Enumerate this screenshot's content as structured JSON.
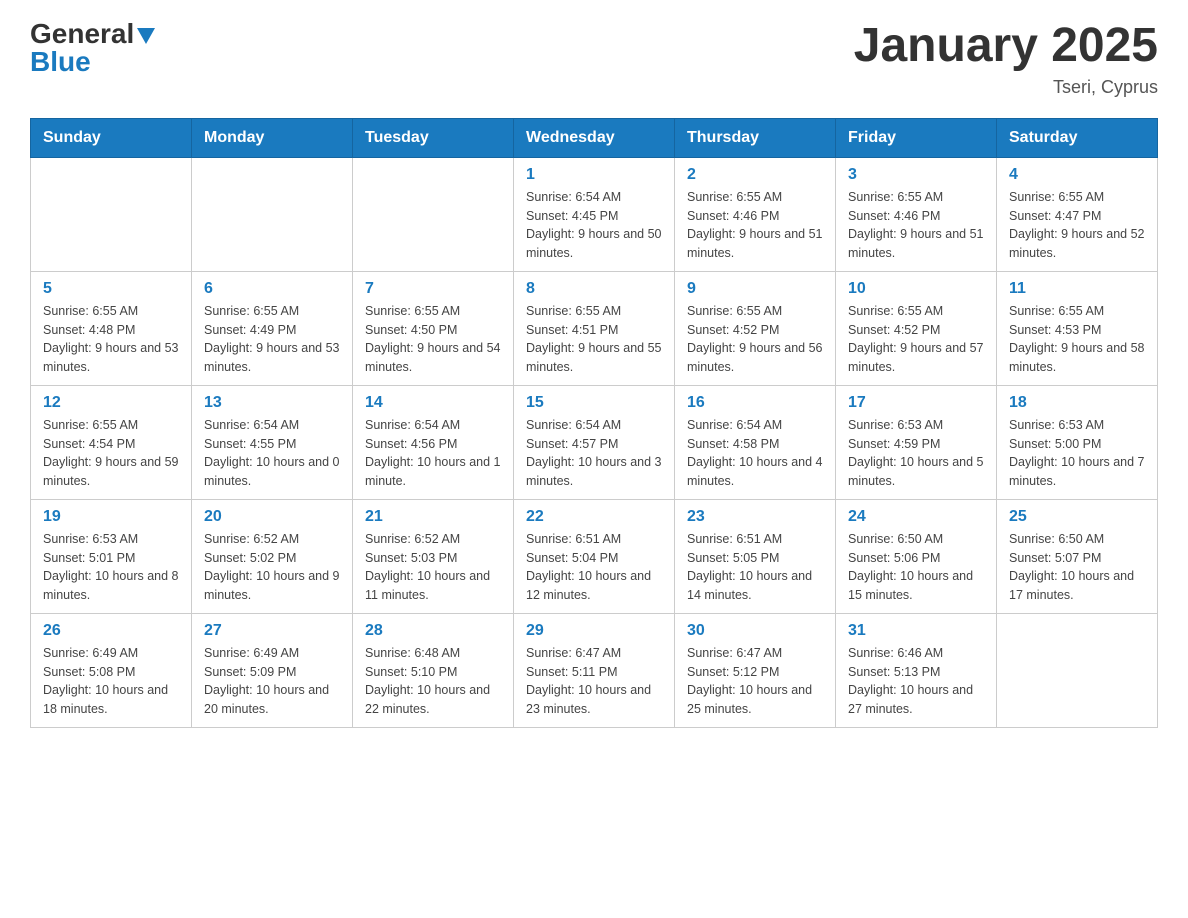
{
  "header": {
    "title": "January 2025",
    "location": "Tseri, Cyprus",
    "logo_general": "General",
    "logo_blue": "Blue"
  },
  "weekdays": [
    "Sunday",
    "Monday",
    "Tuesday",
    "Wednesday",
    "Thursday",
    "Friday",
    "Saturday"
  ],
  "weeks": [
    [
      {
        "day": null
      },
      {
        "day": null
      },
      {
        "day": null
      },
      {
        "day": "1",
        "sunrise": "6:54 AM",
        "sunset": "4:45 PM",
        "daylight": "9 hours and 50 minutes."
      },
      {
        "day": "2",
        "sunrise": "6:55 AM",
        "sunset": "4:46 PM",
        "daylight": "9 hours and 51 minutes."
      },
      {
        "day": "3",
        "sunrise": "6:55 AM",
        "sunset": "4:46 PM",
        "daylight": "9 hours and 51 minutes."
      },
      {
        "day": "4",
        "sunrise": "6:55 AM",
        "sunset": "4:47 PM",
        "daylight": "9 hours and 52 minutes."
      }
    ],
    [
      {
        "day": "5",
        "sunrise": "6:55 AM",
        "sunset": "4:48 PM",
        "daylight": "9 hours and 53 minutes."
      },
      {
        "day": "6",
        "sunrise": "6:55 AM",
        "sunset": "4:49 PM",
        "daylight": "9 hours and 53 minutes."
      },
      {
        "day": "7",
        "sunrise": "6:55 AM",
        "sunset": "4:50 PM",
        "daylight": "9 hours and 54 minutes."
      },
      {
        "day": "8",
        "sunrise": "6:55 AM",
        "sunset": "4:51 PM",
        "daylight": "9 hours and 55 minutes."
      },
      {
        "day": "9",
        "sunrise": "6:55 AM",
        "sunset": "4:52 PM",
        "daylight": "9 hours and 56 minutes."
      },
      {
        "day": "10",
        "sunrise": "6:55 AM",
        "sunset": "4:52 PM",
        "daylight": "9 hours and 57 minutes."
      },
      {
        "day": "11",
        "sunrise": "6:55 AM",
        "sunset": "4:53 PM",
        "daylight": "9 hours and 58 minutes."
      }
    ],
    [
      {
        "day": "12",
        "sunrise": "6:55 AM",
        "sunset": "4:54 PM",
        "daylight": "9 hours and 59 minutes."
      },
      {
        "day": "13",
        "sunrise": "6:54 AM",
        "sunset": "4:55 PM",
        "daylight": "10 hours and 0 minutes."
      },
      {
        "day": "14",
        "sunrise": "6:54 AM",
        "sunset": "4:56 PM",
        "daylight": "10 hours and 1 minute."
      },
      {
        "day": "15",
        "sunrise": "6:54 AM",
        "sunset": "4:57 PM",
        "daylight": "10 hours and 3 minutes."
      },
      {
        "day": "16",
        "sunrise": "6:54 AM",
        "sunset": "4:58 PM",
        "daylight": "10 hours and 4 minutes."
      },
      {
        "day": "17",
        "sunrise": "6:53 AM",
        "sunset": "4:59 PM",
        "daylight": "10 hours and 5 minutes."
      },
      {
        "day": "18",
        "sunrise": "6:53 AM",
        "sunset": "5:00 PM",
        "daylight": "10 hours and 7 minutes."
      }
    ],
    [
      {
        "day": "19",
        "sunrise": "6:53 AM",
        "sunset": "5:01 PM",
        "daylight": "10 hours and 8 minutes."
      },
      {
        "day": "20",
        "sunrise": "6:52 AM",
        "sunset": "5:02 PM",
        "daylight": "10 hours and 9 minutes."
      },
      {
        "day": "21",
        "sunrise": "6:52 AM",
        "sunset": "5:03 PM",
        "daylight": "10 hours and 11 minutes."
      },
      {
        "day": "22",
        "sunrise": "6:51 AM",
        "sunset": "5:04 PM",
        "daylight": "10 hours and 12 minutes."
      },
      {
        "day": "23",
        "sunrise": "6:51 AM",
        "sunset": "5:05 PM",
        "daylight": "10 hours and 14 minutes."
      },
      {
        "day": "24",
        "sunrise": "6:50 AM",
        "sunset": "5:06 PM",
        "daylight": "10 hours and 15 minutes."
      },
      {
        "day": "25",
        "sunrise": "6:50 AM",
        "sunset": "5:07 PM",
        "daylight": "10 hours and 17 minutes."
      }
    ],
    [
      {
        "day": "26",
        "sunrise": "6:49 AM",
        "sunset": "5:08 PM",
        "daylight": "10 hours and 18 minutes."
      },
      {
        "day": "27",
        "sunrise": "6:49 AM",
        "sunset": "5:09 PM",
        "daylight": "10 hours and 20 minutes."
      },
      {
        "day": "28",
        "sunrise": "6:48 AM",
        "sunset": "5:10 PM",
        "daylight": "10 hours and 22 minutes."
      },
      {
        "day": "29",
        "sunrise": "6:47 AM",
        "sunset": "5:11 PM",
        "daylight": "10 hours and 23 minutes."
      },
      {
        "day": "30",
        "sunrise": "6:47 AM",
        "sunset": "5:12 PM",
        "daylight": "10 hours and 25 minutes."
      },
      {
        "day": "31",
        "sunrise": "6:46 AM",
        "sunset": "5:13 PM",
        "daylight": "10 hours and 27 minutes."
      },
      {
        "day": null
      }
    ]
  ]
}
